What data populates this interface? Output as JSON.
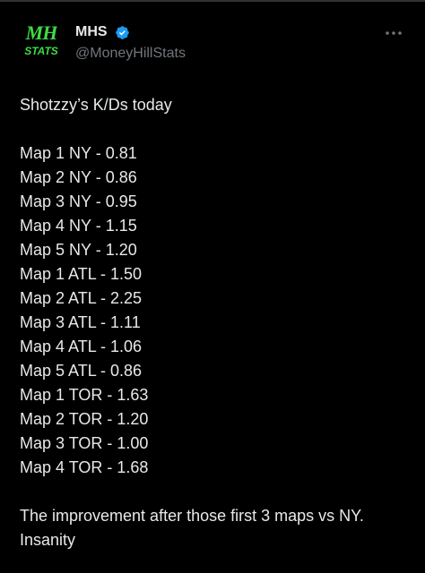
{
  "author": {
    "display_name": "MHS",
    "handle": "@MoneyHillStats",
    "avatar_text_line1": "MH",
    "avatar_text_line2": "STATS",
    "verified": true
  },
  "tweet": {
    "intro": "Shotzzy’s K/Ds today",
    "stats": [
      "Map 1 NY - 0.81",
      "Map 2 NY - 0.86",
      "Map 3 NY - 0.95",
      "Map 4 NY - 1.15",
      "Map 5 NY - 1.20",
      "Map 1 ATL - 1.50",
      "Map 2 ATL - 2.25",
      "Map 3 ATL - 1.11",
      "Map 4 ATL - 1.06",
      "Map 5 ATL - 0.86",
      "Map 1 TOR - 1.63",
      "Map 2 TOR - 1.20",
      "Map 3 TOR - 1.00",
      "Map 4 TOR - 1.68"
    ],
    "outro": [
      "The improvement after those first 3 maps vs NY.",
      "Insanity"
    ]
  },
  "colors": {
    "background": "#000000",
    "text_primary": "#e7e9ea",
    "text_secondary": "#71767b",
    "verified_blue": "#1d9bf0",
    "avatar_green": "#3ddc45"
  },
  "icons": {
    "verified": "verified-badge-icon",
    "more": "more-options-icon"
  }
}
